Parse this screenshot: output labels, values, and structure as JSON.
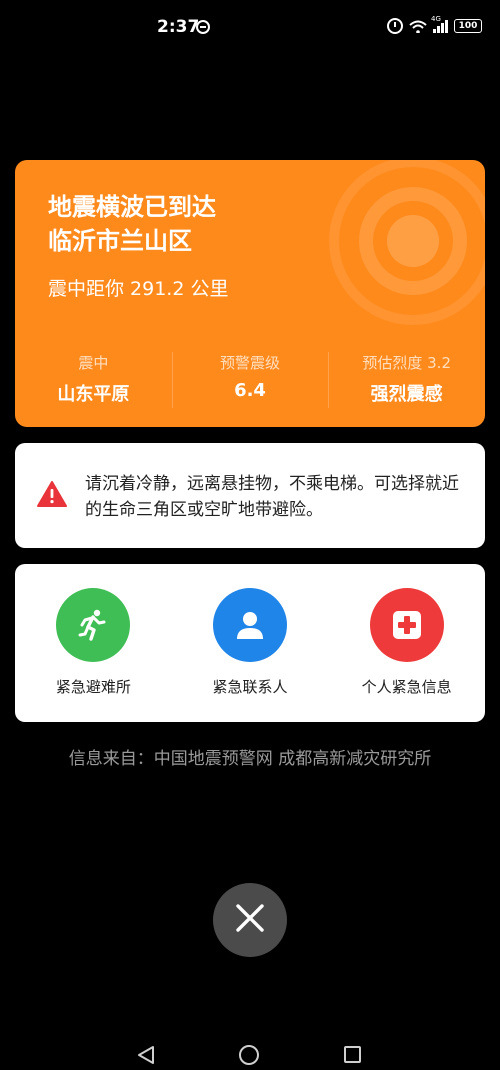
{
  "status_bar": {
    "time": "2:37",
    "network": "4G",
    "battery": "100",
    "icons": [
      "dnd-icon",
      "alarm-icon",
      "wifi-icon",
      "signal-icon",
      "battery-icon"
    ]
  },
  "alert": {
    "title_line1": "地震横波已到达",
    "title_line2": "临沂市兰山区",
    "distance": "震中距你 291.2 公里",
    "stats": [
      {
        "label": "震中",
        "value": "山东平原"
      },
      {
        "label": "预警震级",
        "value": "6.4"
      },
      {
        "label": "预估烈度 3.2",
        "value": "强烈震感"
      }
    ],
    "color": "#ff8a1c"
  },
  "safety": {
    "icon": "warning-icon",
    "text": "请沉着冷静，远离悬挂物，不乘电梯。可选择就近的生命三角区或空旷地带避险。",
    "icon_color": "#e8343a"
  },
  "actions": [
    {
      "label": "紧急避难所",
      "icon": "running-person-icon",
      "color": "#3fbe55"
    },
    {
      "label": "紧急联系人",
      "icon": "contact-person-icon",
      "color": "#1f85e8"
    },
    {
      "label": "个人紧急信息",
      "icon": "medical-cross-icon",
      "color": "#ee3a3a"
    }
  ],
  "source": "信息来自：中国地震预警网 成都高新减灾研究所",
  "close": {
    "icon": "close-icon"
  },
  "nav": {
    "icons": [
      "back-icon",
      "home-icon",
      "recent-apps-icon"
    ]
  }
}
